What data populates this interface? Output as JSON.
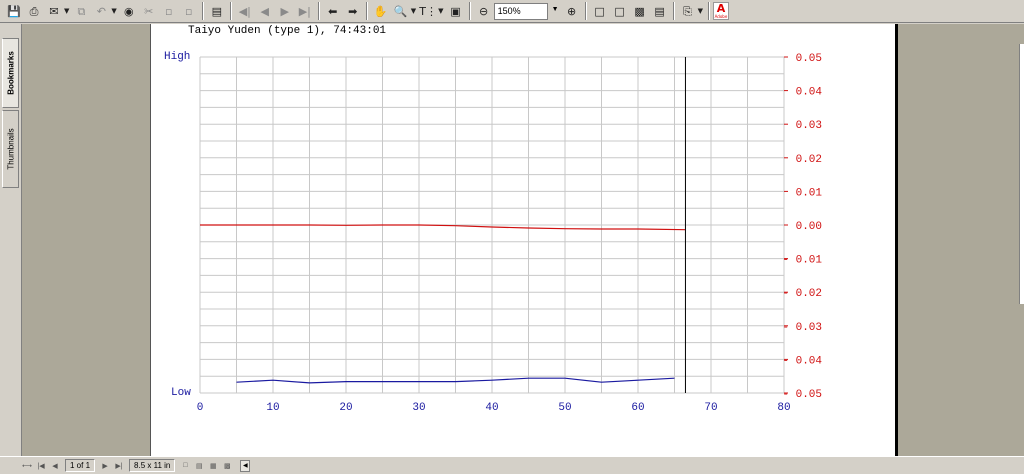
{
  "toolbar": {
    "zoom_value": "150%",
    "acrobat_logo_text": "Adobe"
  },
  "nav": {
    "tabs": [
      {
        "label": "Bookmarks"
      },
      {
        "label": "Thumbnails"
      }
    ]
  },
  "document": {
    "title": "Taiyo Yuden (type 1), 74:43:01",
    "left_axis_high": "High",
    "left_axis_low": "Low"
  },
  "status": {
    "page_indicator": "1 of 1",
    "page_size": "8.5 x 11 in"
  },
  "colors": {
    "red_series": "#d01010",
    "blue_series": "#1a1aa0",
    "grid": "#c8c8c8",
    "right_axis_text": "#d01010"
  },
  "chart_data": {
    "type": "line",
    "title": "Taiyo Yuden (type 1), 74:43:01",
    "xlim": [
      0,
      80
    ],
    "x_ticks": [
      0,
      10,
      20,
      30,
      40,
      50,
      60,
      70,
      80
    ],
    "y_right_lim": [
      -0.05,
      0.05
    ],
    "y_right_ticks": [
      "0.05",
      "0.04",
      "0.03",
      "0.02",
      "0.01",
      "0.00",
      "- 0.01",
      "- 0.02",
      "- 0.03",
      "- 0.04",
      "- 0.05"
    ],
    "y_left_labels": [
      "High",
      "Low"
    ],
    "grid": true,
    "vertical_marker_x": 66.5,
    "series": [
      {
        "color": "#d01010",
        "axis": "right",
        "x": [
          0,
          5,
          10,
          15,
          20,
          25,
          30,
          35,
          40,
          45,
          50,
          55,
          60,
          66.5
        ],
        "y": [
          0.0,
          0.0,
          0.0,
          0.0,
          -0.0001,
          0.0,
          0.0,
          -0.0002,
          -0.0006,
          -0.0009,
          -0.0011,
          -0.0012,
          -0.0012,
          -0.0014
        ]
      },
      {
        "color": "#1a1aa0",
        "axis": "right",
        "x": [
          5,
          10,
          15,
          20,
          25,
          30,
          35,
          40,
          45,
          50,
          55,
          60,
          65
        ],
        "y": [
          -0.0468,
          -0.0462,
          -0.047,
          -0.0466,
          -0.0466,
          -0.0466,
          -0.0466,
          -0.0462,
          -0.0456,
          -0.0456,
          -0.0468,
          -0.0462,
          -0.0456
        ]
      }
    ]
  }
}
